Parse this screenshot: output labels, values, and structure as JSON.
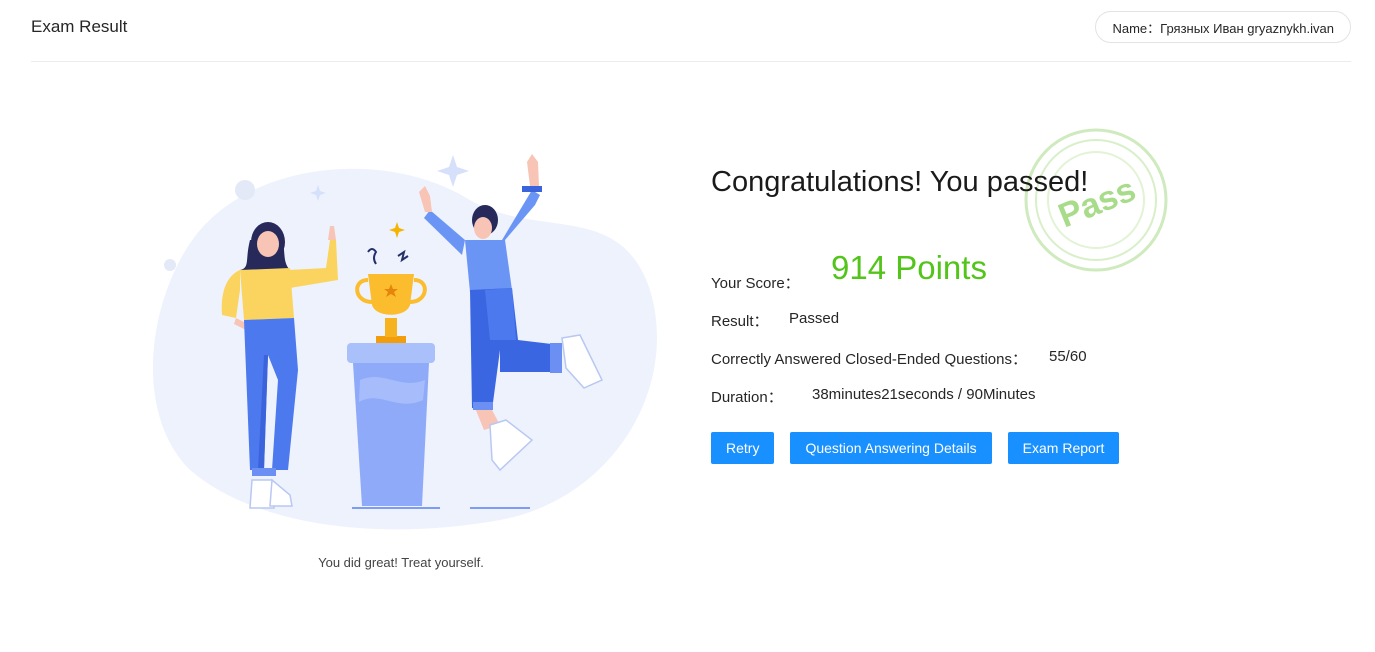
{
  "header": {
    "title": "Exam Result",
    "name_label": "Name：Грязных Иван gryaznykh.ivan"
  },
  "illustration": {
    "caption": "You did great! Treat yourself."
  },
  "result": {
    "headline": "Congratulations! You passed!",
    "score_label": "Your Score：",
    "score_value": "914 Points",
    "result_label": "Result：",
    "result_value": "Passed",
    "correct_label": "Correctly Answered Closed-Ended Questions：",
    "correct_value": "55/60",
    "duration_label": "Duration：",
    "duration_value": "38minutes21seconds / 90Minutes",
    "stamp_text": "Pass"
  },
  "buttons": {
    "retry": "Retry",
    "details": "Question Answering Details",
    "report": "Exam Report"
  },
  "colors": {
    "primary": "#1890ff",
    "score": "#52c41a",
    "stamp": "#95d475"
  }
}
